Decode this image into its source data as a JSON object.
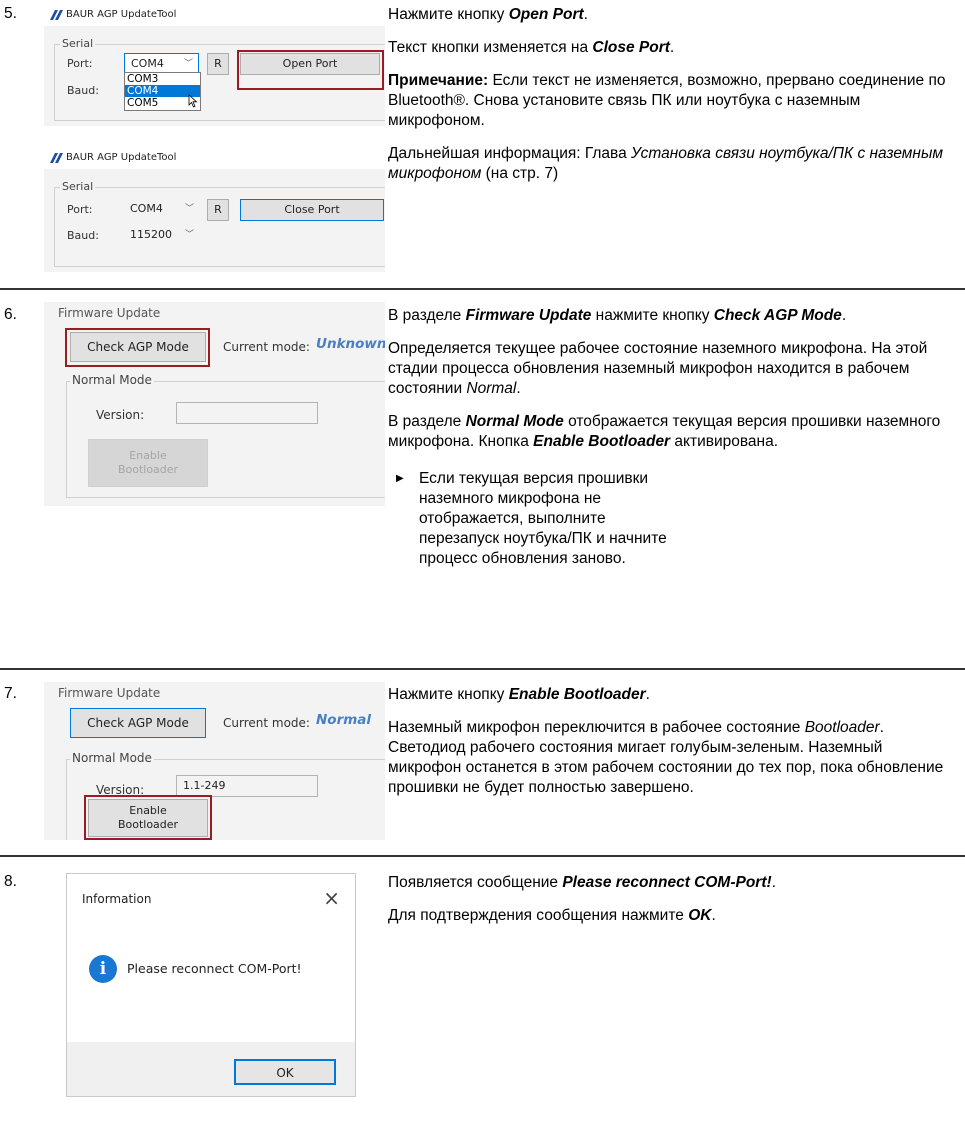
{
  "steps": [
    {
      "number": "5.",
      "paragraphs": {
        "p1": {
          "pre": "Нажмите кнопку ",
          "em": "Open Port",
          "post": "."
        },
        "p2": {
          "pre": "Текст кнопки изменяется на ",
          "em": "Close Port",
          "post": "."
        },
        "p3": {
          "strong": "Примечание:",
          "text": " Если текст не изменяется, возможно, прервано соединение по Bluetooth®. Снова установите связь ПК или ноутбука с наземным микрофоном."
        },
        "p4": {
          "pre": "Дальнейшая информация: Глава ",
          "italic": "Установка связи ноутбука/ПК с наземным микрофоном",
          "post": " (на стр. 7)"
        }
      },
      "screen": {
        "app_title": "BAUR AGP UpdateTool",
        "group_label": "Serial",
        "port_label": "Port:",
        "baud_label": "Baud:",
        "port_value": "COM4",
        "r_button": "R",
        "open_port_button": "Open Port",
        "dropdown_options": [
          "COM3",
          "COM4",
          "COM5"
        ],
        "selected_option": "COM4"
      },
      "screen2": {
        "app_title": "BAUR AGP UpdateTool",
        "group_label": "Serial",
        "port_label": "Port:",
        "baud_label": "Baud:",
        "port_value": "COM4",
        "baud_value": "115200",
        "r_button": "R",
        "close_port_button": "Close Port"
      }
    },
    {
      "number": "6.",
      "paragraphs": {
        "p1": {
          "pre": "В разделе ",
          "em1": "Firmware Update",
          "mid": " нажмите кнопку ",
          "em2": "Check AGP Mode",
          "post": "."
        },
        "p2": {
          "text": "Определяется текущее рабочее состояние наземного микрофона. На этой стадии процесса обновления наземный микрофон находится в рабочем состоянии ",
          "italic": "Normal",
          "post": "."
        },
        "p3": {
          "pre": "В разделе ",
          "em1": "Normal Mode",
          "mid": " отображается текущая версия прошивки наземного микрофона. Кнопка ",
          "em2": "Enable Bootloader",
          "post": " активирована."
        },
        "bullet": "Если текущая версия прошивки наземного микрофона не отображается, выполните перезапуск ноутбука/ПК и начните процесс обновления заново."
      },
      "screen": {
        "group_title": "Firmware Update",
        "check_button": "Check AGP Mode",
        "current_mode_label": "Current mode:",
        "current_mode_value": "Unknown",
        "normal_mode_label": "Normal Mode",
        "version_label": "Version:",
        "version_value": "",
        "enable_button_line1": "Enable",
        "enable_button_line2": "Bootloader"
      }
    },
    {
      "number": "7.",
      "paragraphs": {
        "p1": {
          "pre": "Нажмите кнопку ",
          "em": "Enable Bootloader",
          "post": "."
        },
        "p2": {
          "pre": "Наземный микрофон переключится в рабочее состояние ",
          "italic": "Bootloader",
          "post": ". Светодиод рабочего состояния мигает голубым-зеленым. Наземный микрофон останется в этом рабочем состоянии до тех пор, пока обновление прошивки не будет полностью завершено."
        }
      },
      "screen": {
        "group_title": "Firmware Update",
        "check_button": "Check AGP Mode",
        "current_mode_label": "Current mode:",
        "current_mode_value": "Normal",
        "normal_mode_label": "Normal Mode",
        "version_label": "Version:",
        "version_value": "1.1-249",
        "enable_button_line1": "Enable",
        "enable_button_line2": "Bootloader"
      }
    },
    {
      "number": "8.",
      "paragraphs": {
        "p1": {
          "pre": "Появляется сообщение ",
          "em": "Please reconnect COM-Port!",
          "post": "."
        },
        "p2": {
          "pre": "Для подтверждения сообщения нажмите ",
          "em": "OK",
          "post": "."
        }
      },
      "dialog": {
        "title": "Information",
        "close_glyph": "×",
        "message": "Please reconnect COM-Port!",
        "icon_glyph": "i",
        "ok_button": "OK"
      }
    }
  ],
  "colors": {
    "highlight_red": "#9b1b22",
    "focus_blue": "#0078d7",
    "mode_blue": "#4a7fc6",
    "info_icon_blue": "#1a77d2"
  },
  "icons": {
    "bullet": "triangle-right-icon",
    "logo": "baur-logo-icon",
    "info": "info-icon",
    "close": "close-icon"
  }
}
